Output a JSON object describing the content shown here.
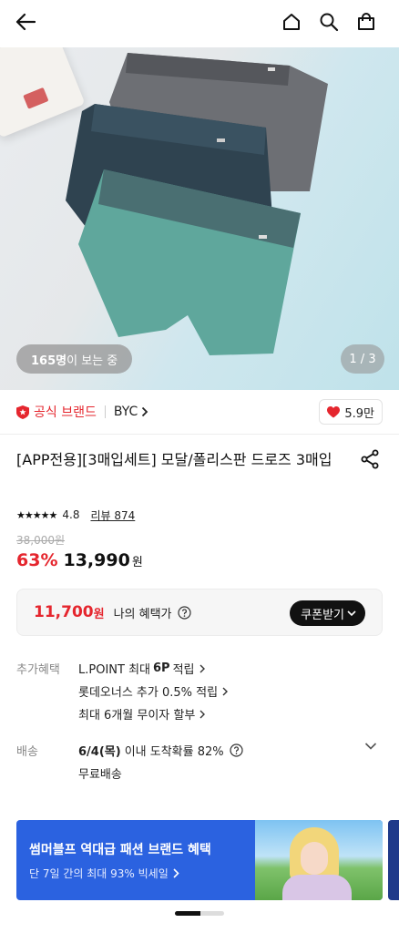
{
  "header": {
    "back_icon": "arrow-left-icon",
    "home_icon": "home-icon",
    "search_icon": "search-icon",
    "bag_icon": "shopping-bag-icon"
  },
  "hero": {
    "viewers_count": "165명",
    "viewers_suffix": "이 보는 중",
    "pager": "1 / 3",
    "underwear_colors": [
      "#6d6f74",
      "#2f4350",
      "#5fa79c"
    ]
  },
  "brand": {
    "official_label": "공식 브랜드",
    "name": "BYC",
    "likes": "5.9만",
    "accent_color": "#e5262e"
  },
  "product": {
    "title": "[APP전용][3매입세트] 모달/폴리스판 드로즈 3매입",
    "rating": "4.8",
    "stars_filled": 5,
    "review_label": "리뷰 874",
    "original_price": "38,000원",
    "discount": "63%",
    "price": "13,990",
    "price_unit": "원"
  },
  "benefit": {
    "amount": "11,700",
    "amount_unit": "원",
    "label": "나의 혜택가",
    "coupon_button": "쿠폰받기"
  },
  "extra_benefits": {
    "label": "추가혜택",
    "lines": [
      {
        "pre": "L.POINT 최대",
        "bold": "6P",
        "post": "적립"
      },
      {
        "text": "롯데오너스 추가 0.5% 적립"
      },
      {
        "text": "최대 6개월 무이자 할부"
      }
    ]
  },
  "shipping": {
    "label": "배송",
    "date": "6/4(목)",
    "date_suffix": "이내 도착확률 82%",
    "fee": "무료배송"
  },
  "banner": {
    "title": "썸머블프 역대급 패션 브랜드 혜택",
    "subtitle": "단 7일 간의 최대 93% 빅세일",
    "bg_color": "#2b62e0"
  }
}
